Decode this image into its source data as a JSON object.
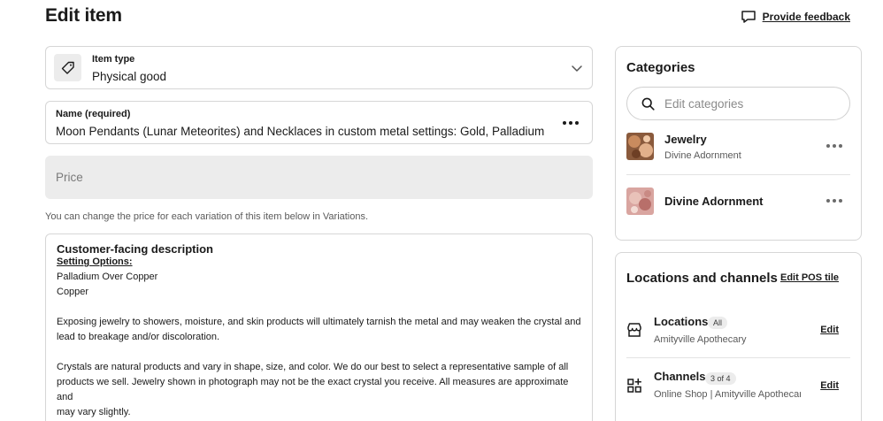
{
  "header": {
    "title": "Edit item",
    "feedback_label": "Provide feedback"
  },
  "item_type": {
    "label": "Item type",
    "value": "Physical good",
    "icon": "tag-icon"
  },
  "name": {
    "label": "Name (required)",
    "value": "Moon Pendants (Lunar Meteorites) and Necklaces in custom metal settings: Gold, Palladium &/or Copper"
  },
  "price": {
    "placeholder": "Price"
  },
  "variations_hint": "You can change the price for each variation of this item below in Variations.",
  "description": {
    "label": "Customer-facing description",
    "subheading": "Setting Options:",
    "lines_group1": [
      "Palladium Over Copper",
      "Copper"
    ],
    "paragraph1": [
      "Exposing jewelry to showers, moisture, and skin products will ultimately tarnish the metal and may weaken the crystal and",
      "lead to breakage and/or discoloration."
    ],
    "paragraph2": [
      "Crystals are natural products and vary in shape, size, and color. We do our best to select a representative sample of all",
      "products we sell. Jewelry shown in photograph may not be the exact crystal you receive. All measures are approximate and",
      "may vary slightly."
    ]
  },
  "categories": {
    "title": "Categories",
    "search_placeholder": "Edit categories",
    "items": [
      {
        "name": "Jewelry",
        "parent": "Divine Adornment"
      },
      {
        "name": "Divine Adornment",
        "parent": ""
      }
    ]
  },
  "channels": {
    "title": "Locations and channels",
    "edit_pos_label": "Edit POS tile",
    "rows": [
      {
        "name": "Locations",
        "badge": "All",
        "detail": "Amityville Apothecary",
        "edit_label": "Edit",
        "icon": "store-icon"
      },
      {
        "name": "Channels",
        "badge": "3 of 4",
        "detail": "Online Shop | Amityville Apothecary",
        "edit_label": "Edit",
        "icon": "add-grid-icon"
      }
    ]
  },
  "colors": {
    "border": "#d6d6d6",
    "disabled_fill": "#ececec",
    "text": "#1a1a1a"
  }
}
